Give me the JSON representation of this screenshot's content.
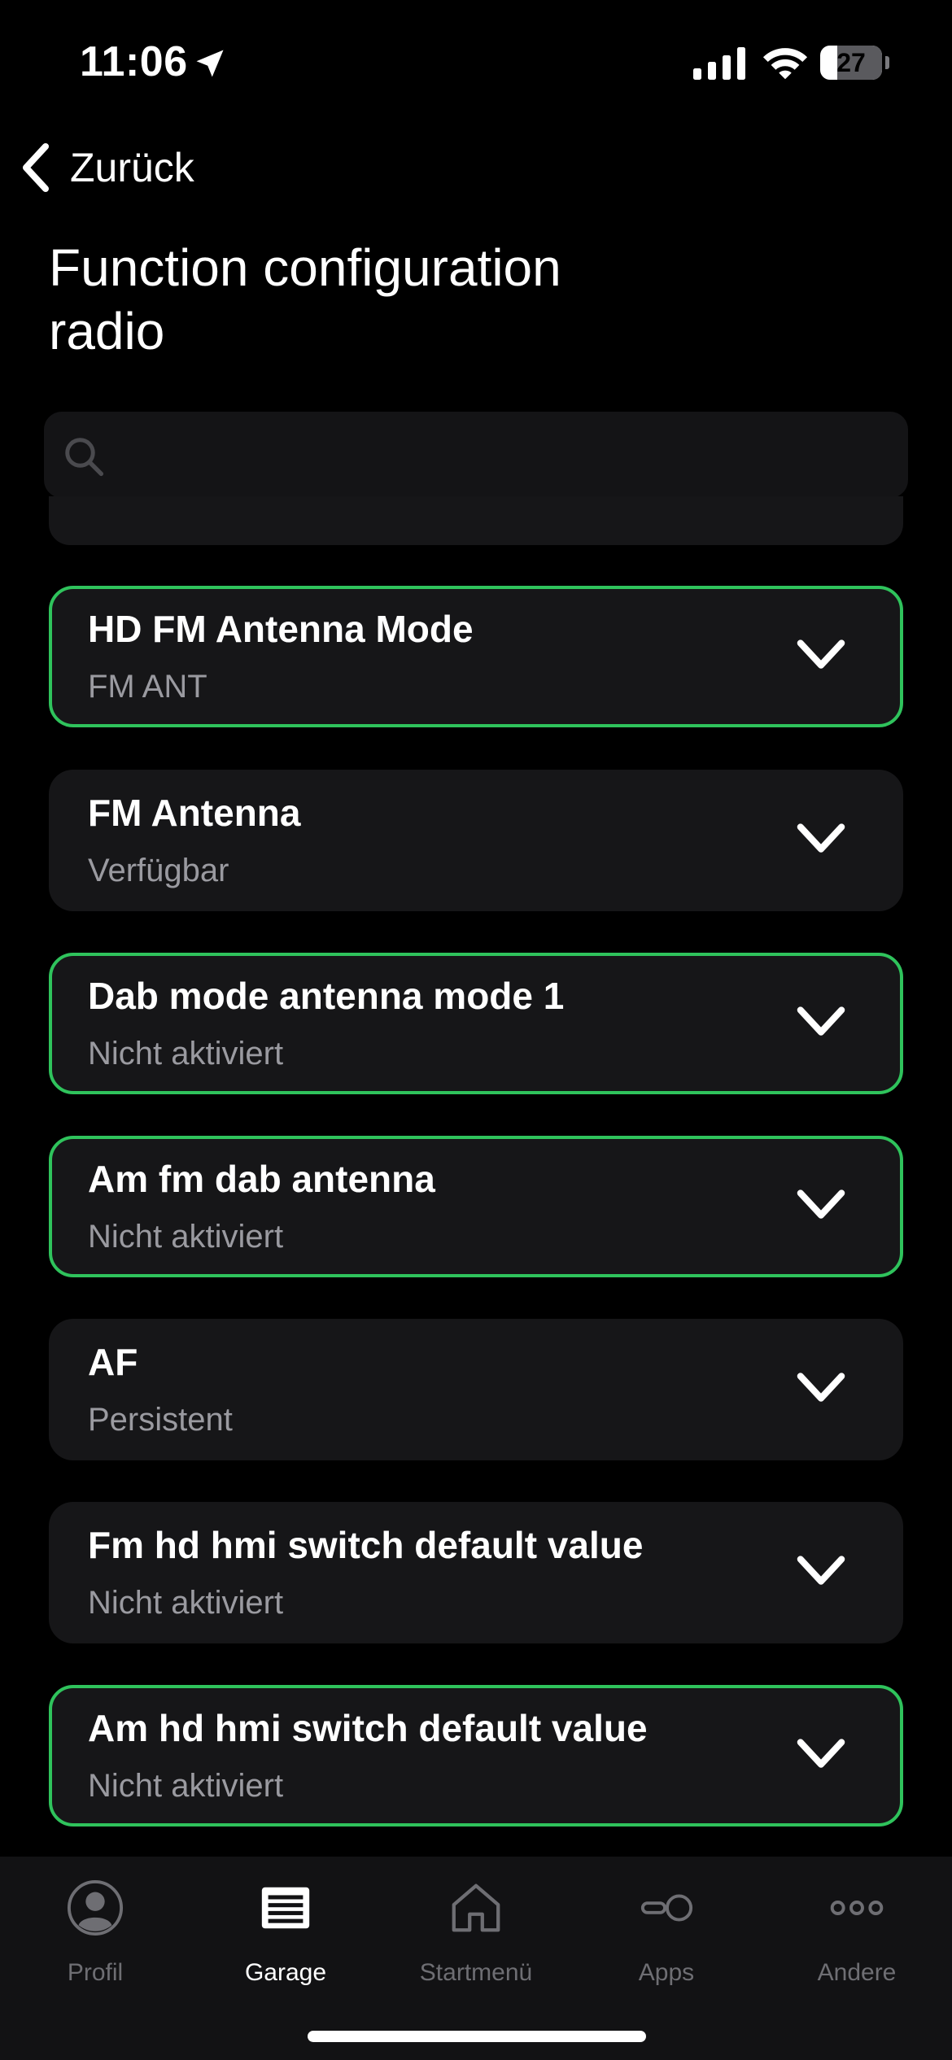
{
  "status_bar": {
    "time": "11:06",
    "battery": "27",
    "battery_level": 0.27
  },
  "nav": {
    "back_label": "Zurück",
    "title": "Function configuration radio"
  },
  "search": {
    "value": "",
    "placeholder": ""
  },
  "settings": [
    {
      "title": "HD FM Antenna Mode",
      "value": "FM ANT",
      "highlighted": true
    },
    {
      "title": "FM Antenna",
      "value": "Verfügbar",
      "highlighted": false
    },
    {
      "title": "Dab mode antenna mode 1",
      "value": "Nicht aktiviert",
      "highlighted": true
    },
    {
      "title": "Am fm dab antenna",
      "value": "Nicht aktiviert",
      "highlighted": true
    },
    {
      "title": "AF",
      "value": "Persistent",
      "highlighted": false
    },
    {
      "title": "Fm hd hmi switch default value",
      "value": "Nicht aktiviert",
      "highlighted": false
    },
    {
      "title": "Am hd hmi switch default value",
      "value": "Nicht aktiviert",
      "highlighted": true
    }
  ],
  "tab_bar": {
    "items": [
      {
        "label": "Profil",
        "icon": "person-circle-icon",
        "selected": false
      },
      {
        "label": "Garage",
        "icon": "garage-icon",
        "selected": true
      },
      {
        "label": "Startmenü",
        "icon": "home-icon",
        "selected": false
      },
      {
        "label": "Apps",
        "icon": "apps-icon",
        "selected": false
      },
      {
        "label": "Andere",
        "icon": "more-icon",
        "selected": false
      }
    ]
  },
  "colors": {
    "background": "#000000",
    "card": "#161618",
    "accent_border": "#2fc35c",
    "secondary_text": "#9a9aa0",
    "tab_inactive": "#6e6e73"
  }
}
